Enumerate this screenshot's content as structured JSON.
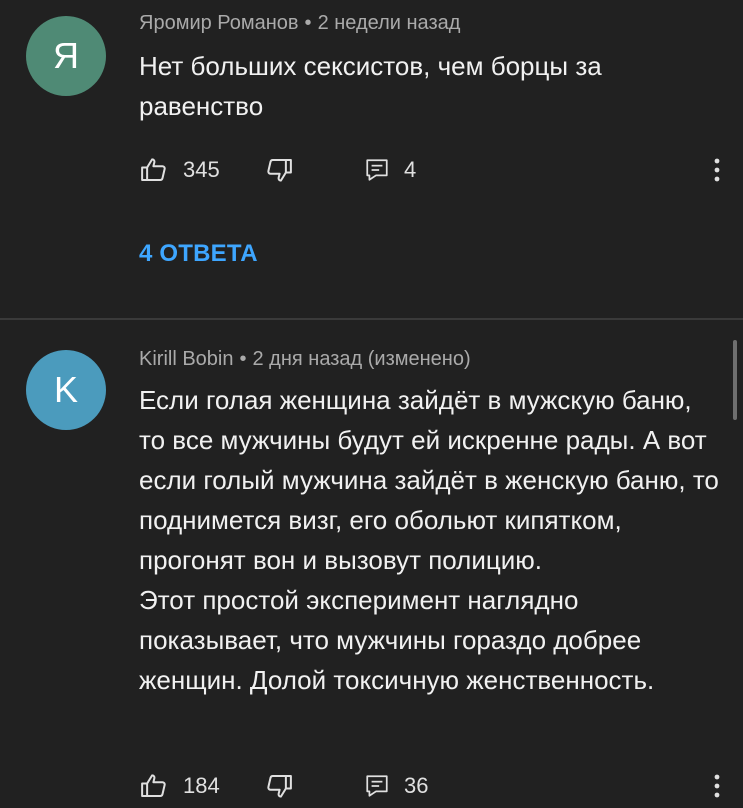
{
  "comments": [
    {
      "avatar_letter": "Я",
      "author": "Яромир Романов",
      "separator": "•",
      "time": "2 недели назад",
      "text_lines": [
        "Нет больших сексистов, чем борцы за равенство"
      ],
      "likes": "345",
      "replies_count": "4",
      "replies_link": "4 ОТВЕТА"
    },
    {
      "avatar_letter": "K",
      "author": "Kirill Bobin",
      "separator": "•",
      "time": "2 дня назад (изменено)",
      "text_lines": [
        "Если голая женщина зайдёт в мужскую баню, то все мужчины будут ей искренне рады. А вот если голый мужчина зайдёт в женскую баню, то поднимется визг, его обольют кипятком, прогонят вон и вызовут полицию.",
        "Этот простой эксперимент наглядно показывает, что мужчины гораздо добрее женщин. Долой токсичную женственность."
      ],
      "likes": "184",
      "replies_count": "36"
    }
  ],
  "icons": {
    "like": "thumb-up-icon",
    "dislike": "thumb-down-icon",
    "reply": "reply-icon",
    "more": "more-vert-icon"
  },
  "colors": {
    "background": "#212121",
    "link": "#3ea6ff",
    "avatar_1": "#4f8a75",
    "avatar_2": "#4b9bbd"
  }
}
